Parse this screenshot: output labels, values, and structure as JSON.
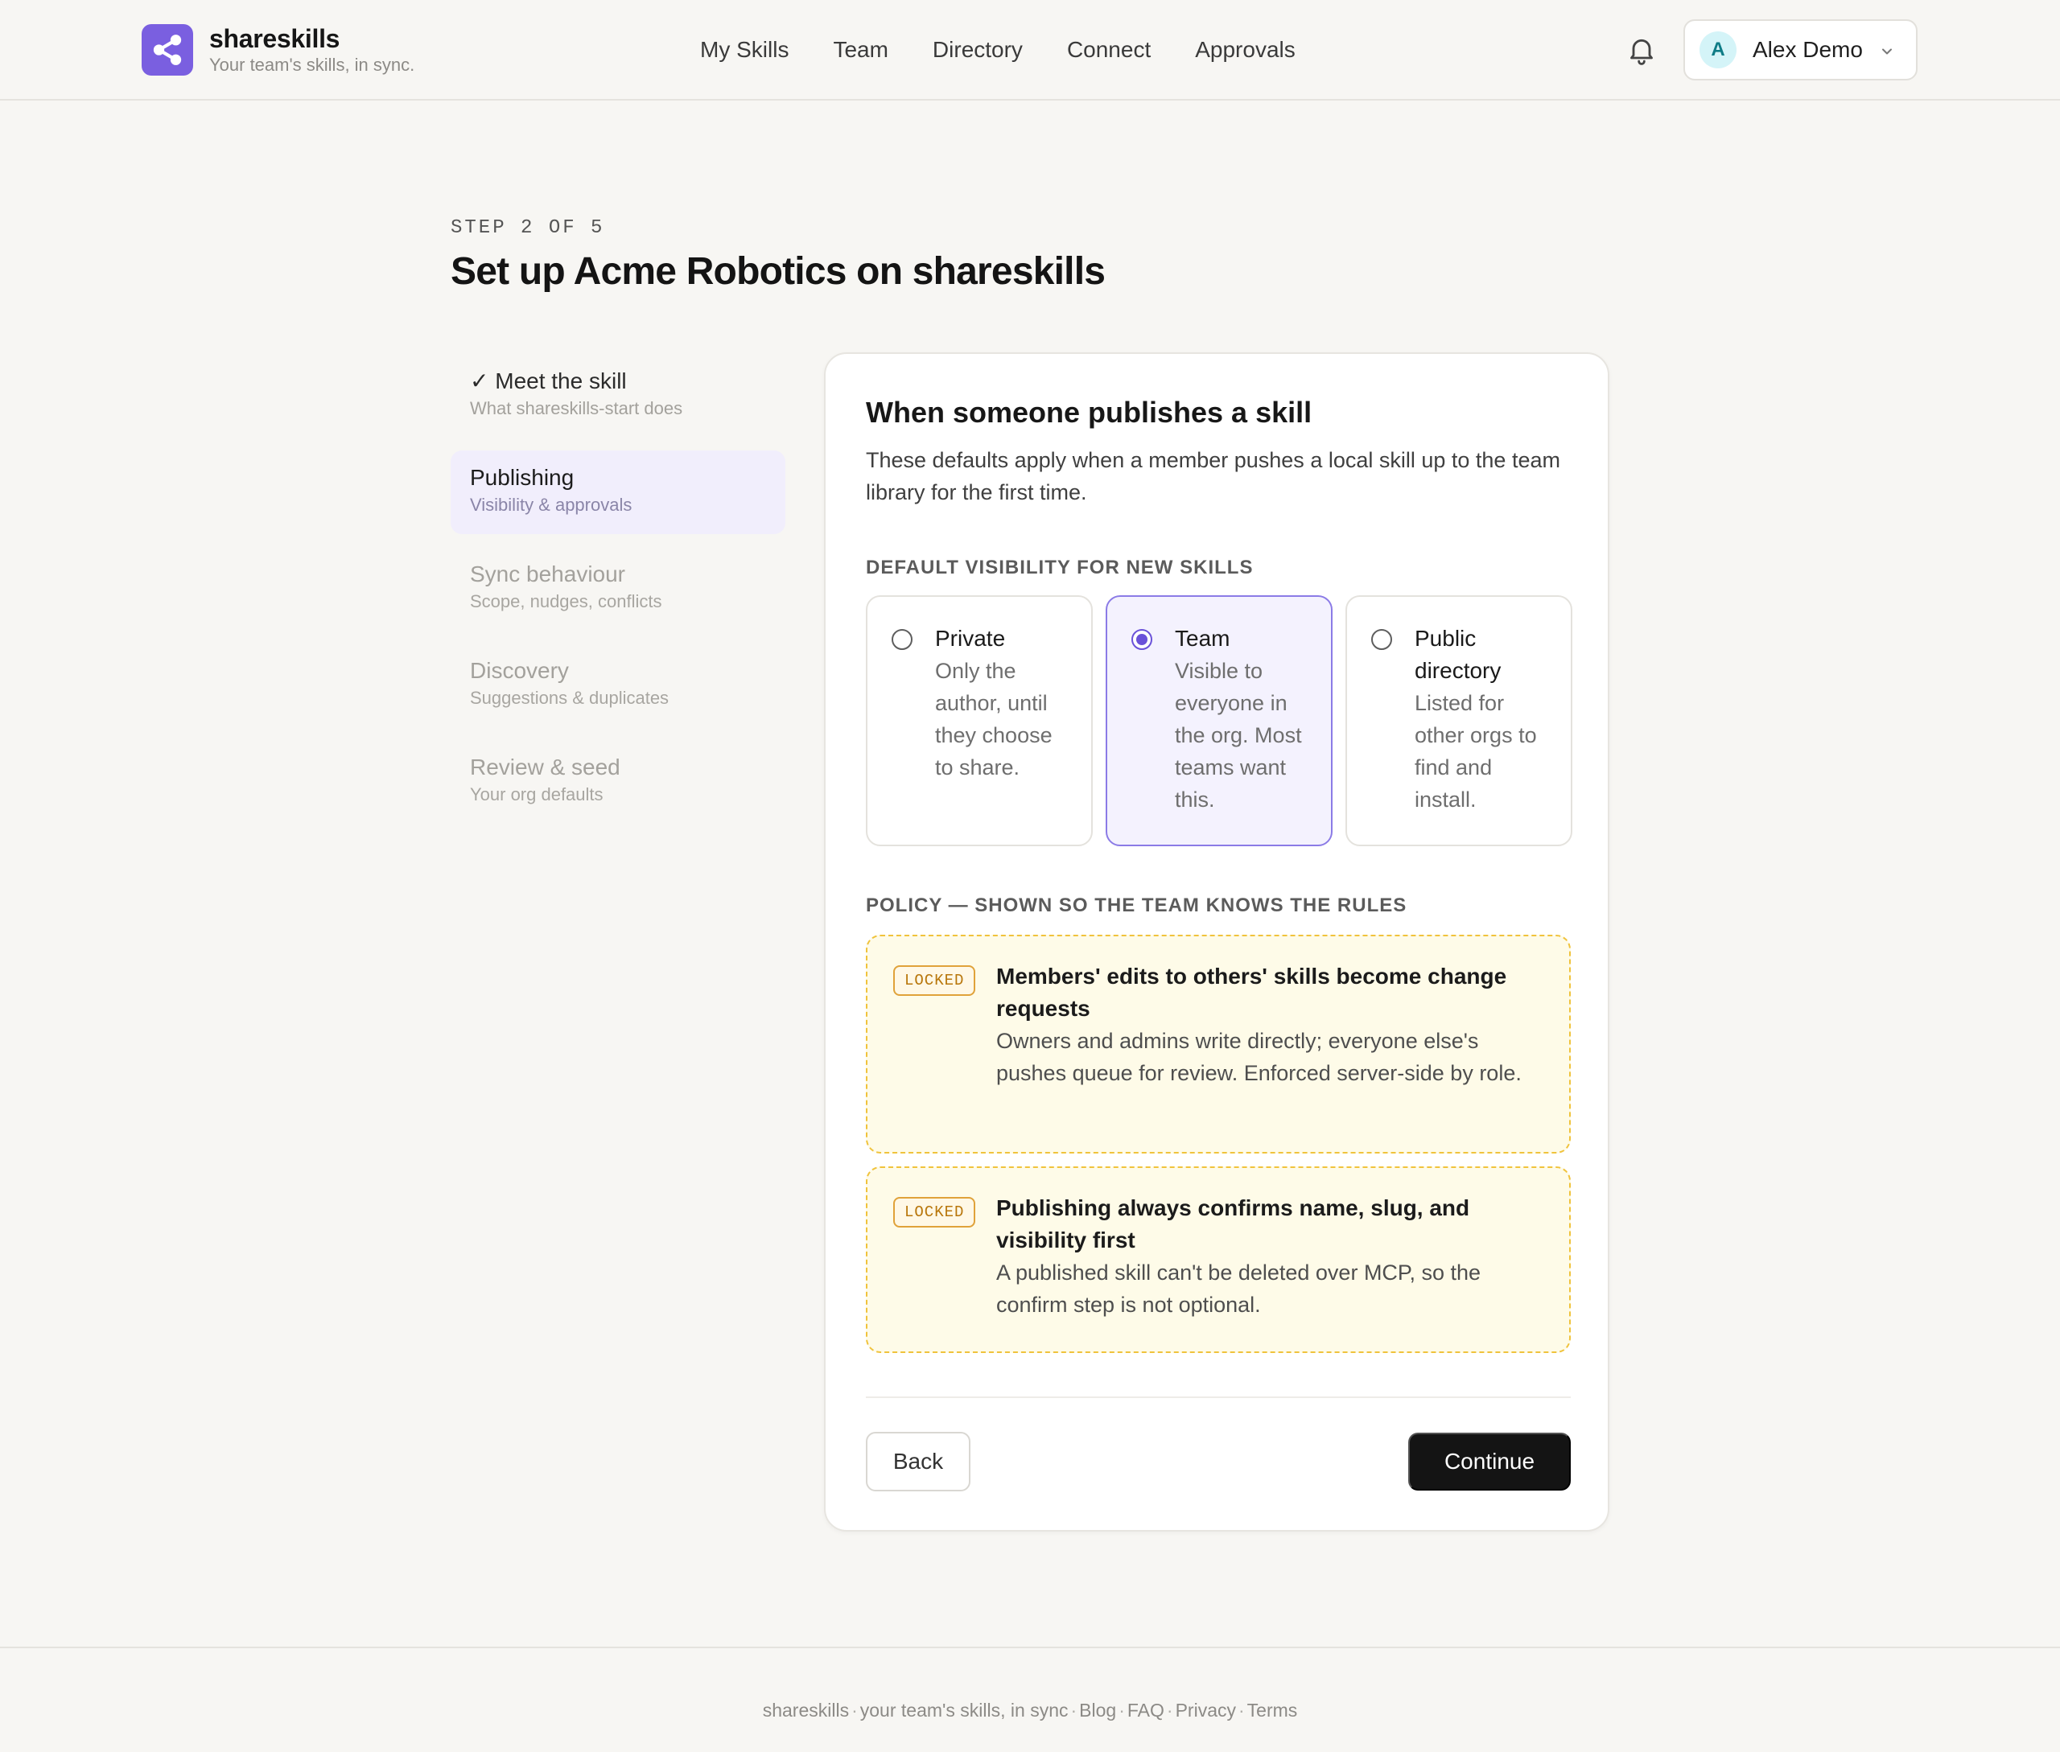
{
  "brand": {
    "name": "shareskills",
    "tagline": "Your team's skills, in sync."
  },
  "nav": {
    "items": [
      "My Skills",
      "Team",
      "Directory",
      "Connect",
      "Approvals"
    ]
  },
  "user": {
    "initial": "A",
    "name": "Alex Demo"
  },
  "header": {
    "step_label": "STEP 2 OF 5",
    "title": "Set up Acme Robotics on shareskills"
  },
  "steps": [
    {
      "title": "✓ Meet the skill",
      "subtitle": "What shareskills-start does",
      "state": "done"
    },
    {
      "title": "Publishing",
      "subtitle": "Visibility & approvals",
      "state": "active"
    },
    {
      "title": "Sync behaviour",
      "subtitle": "Scope, nudges, conflicts",
      "state": "upcoming"
    },
    {
      "title": "Discovery",
      "subtitle": "Suggestions & duplicates",
      "state": "upcoming"
    },
    {
      "title": "Review & seed",
      "subtitle": "Your org defaults",
      "state": "upcoming"
    }
  ],
  "card": {
    "title": "When someone publishes a skill",
    "description": "These defaults apply when a member pushes a local skill up to the team library for the first time.",
    "visibility_label": "DEFAULT VISIBILITY FOR NEW SKILLS",
    "visibility_options": [
      {
        "title": "Private",
        "description": "Only the author, until they choose to share.",
        "selected": false
      },
      {
        "title": "Team",
        "description": "Visible to everyone in the org. Most teams want this.",
        "selected": true
      },
      {
        "title": "Public directory",
        "description": "Listed for other orgs to find and install.",
        "selected": false
      }
    ],
    "policy_label": "POLICY — SHOWN SO THE TEAM KNOWS THE RULES",
    "policies": [
      {
        "badge": "LOCKED",
        "title": "Members' edits to others' skills become change requests",
        "description": "Owners and admins write directly; everyone else's pushes queue for review. Enforced server-side by role."
      },
      {
        "badge": "LOCKED",
        "title": "Publishing always confirms name, slug, and visibility first",
        "description": "A published skill can't be deleted over MCP, so the confirm step is not optional."
      }
    ],
    "back_label": "Back",
    "continue_label": "Continue"
  },
  "footer": {
    "brand": "shareskills",
    "tagline": "your team's skills, in sync",
    "links": [
      "Blog",
      "FAQ",
      "Privacy",
      "Terms"
    ]
  },
  "colors": {
    "accent": "#7a5fe0",
    "selected_bg": "#f4f2fe",
    "locked_border": "#f0c33c",
    "locked_bg": "#fefbe8",
    "primary_button": "#141414"
  }
}
